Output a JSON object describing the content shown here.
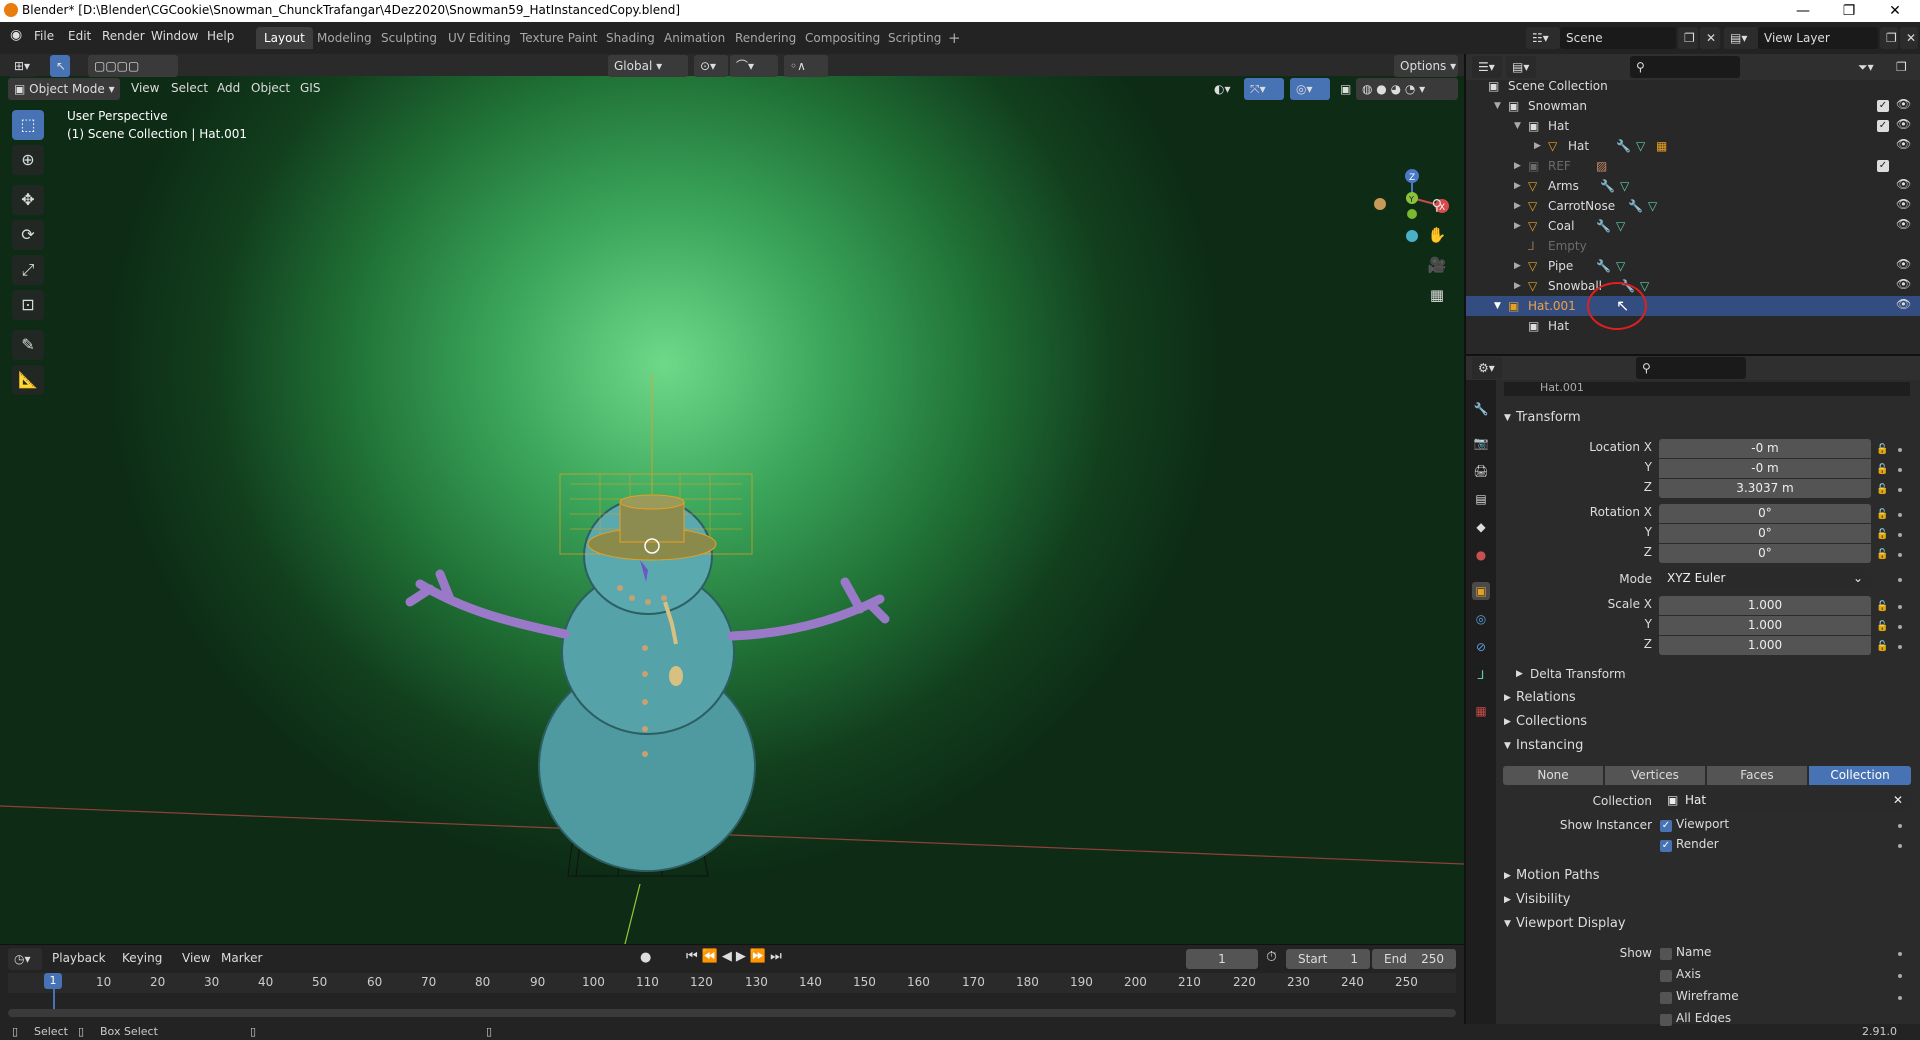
{
  "window": {
    "title": "Blender* [D:\\Blender\\CGCookie\\Snowman_ChunckTrafangar\\4Dez2020\\Snowman59_HatInstancedCopy.blend]",
    "minimize": "—",
    "maximize": "❐",
    "close": "✕"
  },
  "menubar": {
    "items": [
      "File",
      "Edit",
      "Render",
      "Window",
      "Help"
    ],
    "workspaces": [
      "Layout",
      "Modeling",
      "Sculpting",
      "UV Editing",
      "Texture Paint",
      "Shading",
      "Animation",
      "Rendering",
      "Compositing",
      "Scripting"
    ],
    "add_tab": "+",
    "scene_label": "Scene",
    "view_layer_label": "View Layer"
  },
  "viewport": {
    "transform_orientation": "Global",
    "options_label": "Options",
    "mode_label": "Object Mode",
    "menus": [
      "View",
      "Select",
      "Add",
      "Object",
      "GIS"
    ],
    "overlay_line1": "User Perspective",
    "overlay_line2": "(1) Scene Collection | Hat.001",
    "gizmo": {
      "z": "Z",
      "y": "Y",
      "x": "X"
    }
  },
  "outliner": {
    "root": "Scene Collection",
    "rows": [
      {
        "label": "Snowman",
        "type": "collection"
      },
      {
        "label": "Hat",
        "type": "collection"
      },
      {
        "label": "Hat",
        "type": "mesh"
      },
      {
        "label": "REF",
        "type": "collection"
      },
      {
        "label": "Arms",
        "type": "mesh"
      },
      {
        "label": "CarrotNose",
        "type": "mesh"
      },
      {
        "label": "Coal",
        "type": "mesh"
      },
      {
        "label": "Empty",
        "type": "empty"
      },
      {
        "label": "Pipe",
        "type": "mesh"
      },
      {
        "label": "Snowball",
        "type": "mesh"
      },
      {
        "label": "Hat.001",
        "type": "instance"
      },
      {
        "label": "Hat",
        "type": "collection"
      }
    ]
  },
  "properties": {
    "object_name": "Hat.001",
    "transform": {
      "title": "Transform",
      "location_x_label": "Location X",
      "location_x": "-0 m",
      "location_y_label": "Y",
      "location_y": "-0 m",
      "location_z_label": "Z",
      "location_z": "3.3037 m",
      "rotation_x_label": "Rotation X",
      "rotation_x": "0°",
      "rotation_y_label": "Y",
      "rotation_y": "0°",
      "rotation_z_label": "Z",
      "rotation_z": "0°",
      "mode_label": "Mode",
      "mode_value": "XYZ Euler",
      "scale_x_label": "Scale X",
      "scale_x": "1.000",
      "scale_y_label": "Y",
      "scale_y": "1.000",
      "scale_z_label": "Z",
      "scale_z": "1.000",
      "delta": "Delta Transform"
    },
    "sections": {
      "relations": "Relations",
      "collections": "Collections",
      "instancing": "Instancing",
      "motion_paths": "Motion Paths",
      "visibility": "Visibility",
      "viewport_display": "Viewport Display"
    },
    "instancing": {
      "options": [
        "None",
        "Vertices",
        "Faces",
        "Collection"
      ],
      "selected": "Collection",
      "collection_label": "Collection",
      "collection_value": "Hat",
      "show_instancer_label": "Show Instancer",
      "viewport": "Viewport",
      "render": "Render"
    },
    "viewport_display": {
      "show_label": "Show",
      "name": "Name",
      "axis": "Axis",
      "wireframe": "Wireframe",
      "all_edges": "All Edges"
    }
  },
  "timeline": {
    "menus": [
      "Playback",
      "Keying",
      "View",
      "Marker"
    ],
    "current_frame": "1",
    "start_label": "Start",
    "start": "1",
    "end_label": "End",
    "end": "250",
    "ticks": [
      "1",
      "10",
      "20",
      "30",
      "40",
      "50",
      "60",
      "70",
      "80",
      "90",
      "100",
      "110",
      "120",
      "130",
      "140",
      "150",
      "160",
      "170",
      "180",
      "190",
      "200",
      "210",
      "220",
      "230",
      "240",
      "250"
    ]
  },
  "statusbar": {
    "select": "Select",
    "box_select": "Box Select",
    "version": "2.91.0"
  },
  "colors": {
    "accent": "#4772b3",
    "selected_row": "#334d80",
    "orange": "#e87d0d"
  }
}
